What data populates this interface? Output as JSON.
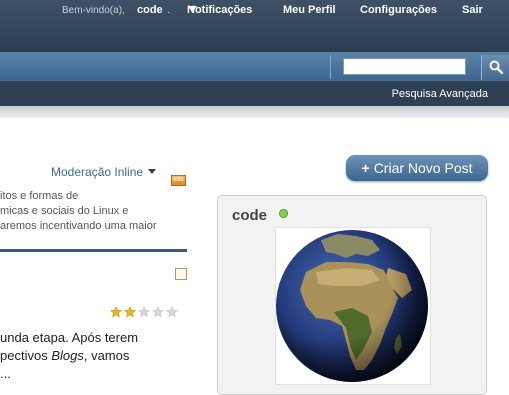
{
  "topnav": {
    "welcome": "Bem-vindo(a),",
    "username": "code",
    "separator": ".",
    "notifications": "Notificações",
    "profile": "Meu Perfil",
    "settings": "Configurações",
    "logout": "Sair"
  },
  "search": {
    "value": "",
    "advanced": "Pesquisa Avançada"
  },
  "blog": {
    "moderation": "Moderação Inline",
    "rss": "RSS",
    "description_lines": [
      "itos e formas de",
      "micas e sociais do Linux e",
      "aremos incentivando uma maior"
    ],
    "rating_stars_filled": 2,
    "rating_stars_total": 5,
    "post_lines": [
      "unda etapa. Após terem",
      "pectivos ",
      "Blogs",
      ", vamos",
      "..."
    ]
  },
  "sidebar": {
    "new_post": "Criar Novo Post",
    "profile_name": "code"
  }
}
